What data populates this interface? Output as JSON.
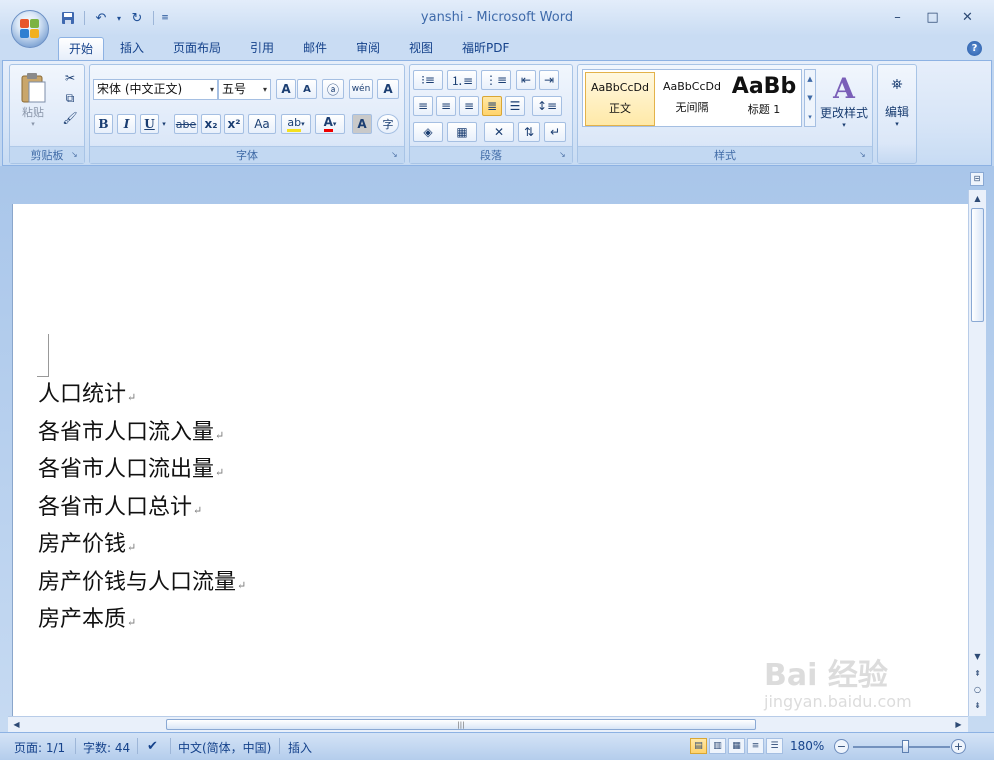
{
  "app": {
    "window_title": "yanshi - Microsoft Word",
    "qat": {
      "save_icon": "save-icon",
      "undo_icon": "undo-icon",
      "redo_icon": "redo-icon"
    },
    "window_controls": {
      "minimize": "–",
      "maximize": "□",
      "close": "✕"
    }
  },
  "tabs": [
    "开始",
    "插入",
    "页面布局",
    "引用",
    "邮件",
    "审阅",
    "视图",
    "福昕PDF"
  ],
  "active_tab": "开始",
  "ribbon": {
    "clipboard": {
      "paste_label": "粘贴",
      "group_label": "剪贴板"
    },
    "font": {
      "font_name": "宋体 (中文正文)",
      "font_size": "五号",
      "group_label": "字体",
      "buttons": {
        "bold": "B",
        "italic": "I",
        "underline": "U",
        "strike": "abe",
        "subscript": "x₂",
        "superscript": "x²",
        "change_case": "Aa",
        "grow": "A",
        "shrink": "A",
        "phonetic": "wén",
        "border_char": "A",
        "shading_char": "A",
        "enclose": "字"
      }
    },
    "paragraph": {
      "group_label": "段落"
    },
    "styles": {
      "group_label": "样式",
      "items": [
        {
          "preview": "AaBbCcDd",
          "name": "正文"
        },
        {
          "preview": "AaBbCcDd",
          "name": "无间隔"
        },
        {
          "preview": "AaBb",
          "name": "标题 1"
        }
      ],
      "change_styles_label": "更改样式"
    },
    "editing": {
      "label": "编辑"
    }
  },
  "document": {
    "lines": [
      "人口统计",
      "各省市人口流入量",
      "各省市人口流出量",
      "各省市人口总计",
      "房产价钱",
      "房产价钱与人口流量",
      "房产本质"
    ],
    "paragraph_mark": "↵"
  },
  "statusbar": {
    "page": "页面: 1/1",
    "words": "字数: 44",
    "language": "中文(简体，中国)",
    "mode": "插入",
    "zoom": "180%"
  },
  "watermark": {
    "line1": "Bai 经验",
    "line2": "jingyan.baidu.com"
  }
}
